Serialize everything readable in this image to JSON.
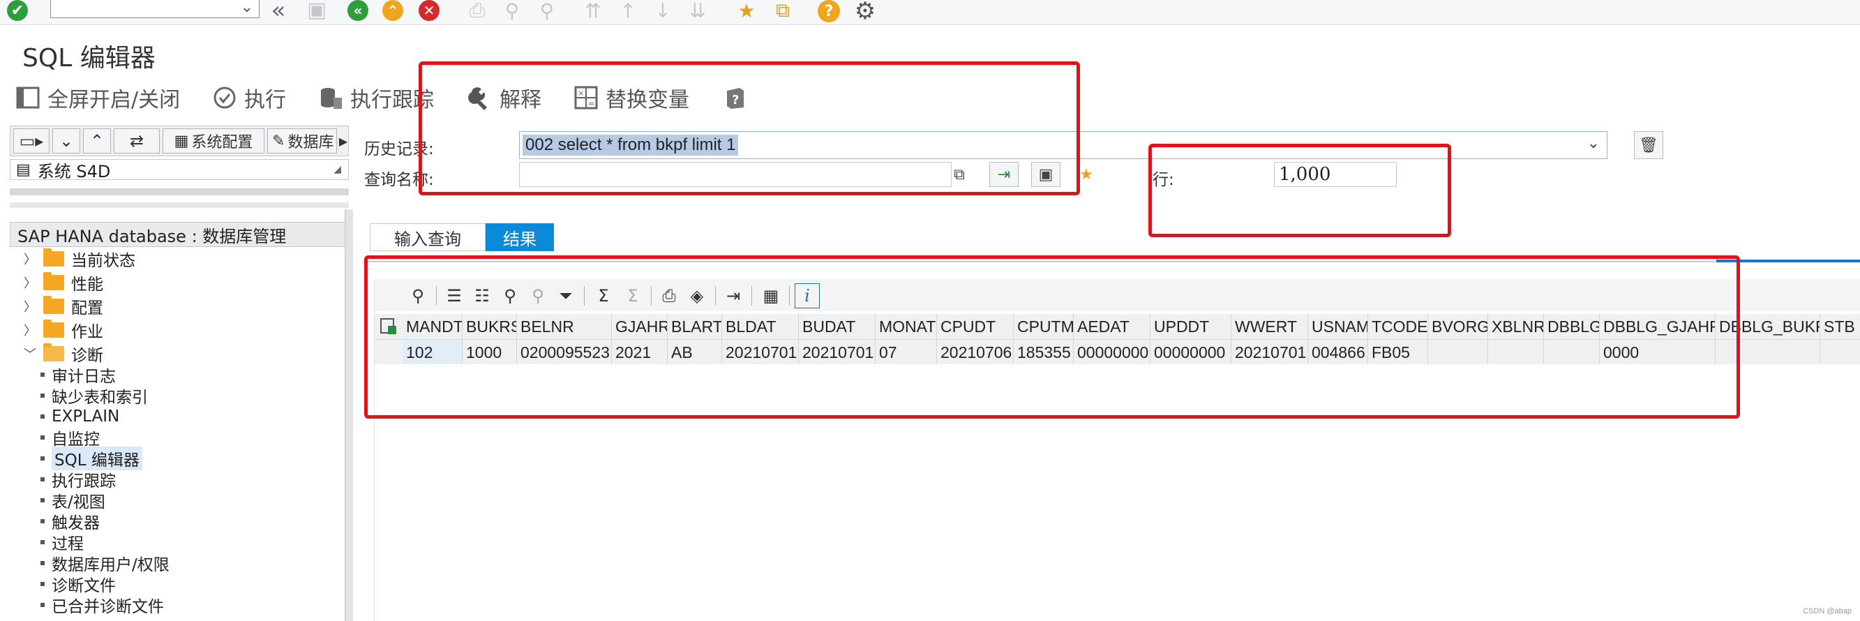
{
  "system_toolbar": {
    "icons": [
      "check-circle-icon",
      "back-icon",
      "save-icon",
      "green-back-icon",
      "up-exit-icon",
      "cancel-icon",
      "print-icon",
      "find-icon",
      "find-next-icon",
      "first-page-icon",
      "prev-page-icon",
      "next-page-icon",
      "last-page-icon",
      "new-session-icon",
      "shortcut-icon",
      "help-icon",
      "settings-gear-icon"
    ]
  },
  "page": {
    "title": "SQL 编辑器"
  },
  "app_toolbar": {
    "fullscreen_label": "全屏开启/关闭",
    "execute_label": "执行",
    "trace_label": "执行跟踪",
    "explain_label": "解释",
    "replace_vars_label": "替换变量"
  },
  "left_panel": {
    "toolbar": {
      "sysconfig_label": "系统配置",
      "database_label": "数据库"
    },
    "system_label": "系统 S4D",
    "tree_header": "SAP HANA database : 数据库管理",
    "folders": [
      {
        "label": "当前状态",
        "expanded": false
      },
      {
        "label": "性能",
        "expanded": false
      },
      {
        "label": "配置",
        "expanded": false
      },
      {
        "label": "作业",
        "expanded": false
      },
      {
        "label": "诊断",
        "expanded": true
      }
    ],
    "leaf_items": [
      "审计日志",
      "缺少表和索引",
      "EXPLAIN",
      "自监控",
      "SQL 编辑器",
      "执行跟踪",
      "表/视图",
      "触发器",
      "过程",
      "数据库用户/权限",
      "诊断文件",
      "已合并诊断文件"
    ],
    "selected_item": "SQL 编辑器"
  },
  "form": {
    "history_label": "历史记录:",
    "history_value": "002 select * from bkpf limit 1",
    "query_name_label": "查询名称:",
    "query_name_value": "",
    "rows_label": "行:",
    "rows_value": "1,000"
  },
  "tabs": [
    {
      "label": "输入查询",
      "active": false
    },
    {
      "label": "结果",
      "active": true
    }
  ],
  "result_grid": {
    "columns": [
      "MANDT",
      "BUKRS",
      "BELNR",
      "GJAHR",
      "BLART",
      "BLDAT",
      "BUDAT",
      "MONAT",
      "CPUDT",
      "CPUTM",
      "AEDAT",
      "UPDDT",
      "WWERT",
      "USNAM",
      "TCODE",
      "BVORG",
      "XBLNR",
      "DBBLG",
      "DBBLG_GJAHR",
      "DBBLG_BUKRS",
      "STB"
    ],
    "rows": [
      [
        "102",
        "1000",
        "0200095523",
        "2021",
        "AB",
        "20210701",
        "20210701",
        "07",
        "20210706",
        "185355",
        "00000000",
        "00000000",
        "20210701",
        "004866",
        "FB05",
        "",
        "",
        "",
        "0000",
        "",
        ""
      ]
    ]
  },
  "colors": {
    "accent": "#0a8ad8",
    "annotation_red": "#e0121a",
    "folder": "#f5a623"
  },
  "watermark": "CSDN @abap"
}
